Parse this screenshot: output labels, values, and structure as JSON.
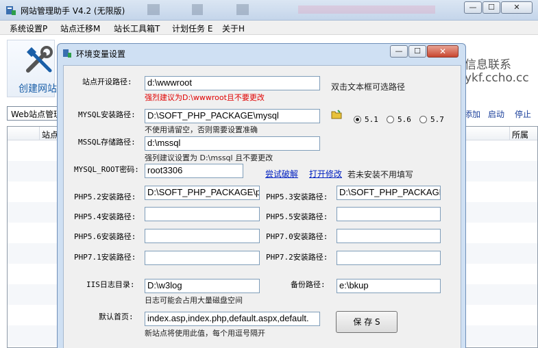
{
  "main": {
    "title": "网站管理助手 V4.2 (无限版)",
    "caption": {
      "min": "—",
      "max": "☐",
      "close": "✕"
    },
    "menu": [
      "系统设置P",
      "站点迁移M",
      "站长工具箱T",
      "计划任务 E",
      "关于H"
    ],
    "toolbar": {
      "create_label": "创建网站",
      "contact_line1": "信息联系",
      "contact_line2": "ykf.ccho.cc"
    },
    "web_field": "Web站点管理",
    "actions": {
      "add": "添加",
      "start": "启动",
      "stop": "停止"
    },
    "table": {
      "col1": "站点",
      "col2": "所属"
    }
  },
  "dialog": {
    "title": "环境变量设置",
    "caption": {
      "min": "—",
      "max": "☐",
      "close": "✕"
    },
    "site_path": {
      "label": "站点开设路径:",
      "value": "d:\\wwwroot",
      "hint": "双击文本框可选路径",
      "warn": "强烈建议为D:\\wwwroot且不要更改"
    },
    "mysql": {
      "label": "MYSQL安装路径:",
      "value": "D:\\SOFT_PHP_PACKAGE\\mysql",
      "note": "不使用请留空，否则需要设置准确"
    },
    "mysql_version": {
      "options": [
        "5.1",
        "5.6",
        "5.7"
      ],
      "selected": "5.1"
    },
    "mssql": {
      "label": "MSSQL存储路径:",
      "value": "d:\\mssql",
      "note": "强列建议设置为 D:\\mssql 且不要更改"
    },
    "mysql_root": {
      "label": "MYSQL_ROOT密码:",
      "value": "root3306",
      "try_link": "尝试破解",
      "open_link": "打开修改",
      "note": "若未安装不用填写"
    },
    "php52": {
      "label": "PHP5.2安装路径:",
      "value": "D:\\SOFT_PHP_PACKAGE\\p"
    },
    "php53": {
      "label": "PHP5.3安装路径:",
      "value": "D:\\SOFT_PHP_PACKAGE"
    },
    "php54": {
      "label": "PHP5.4安装路径:",
      "value": ""
    },
    "php55": {
      "label": "PHP5.5安装路径:",
      "value": ""
    },
    "php56": {
      "label": "PHP5.6安装路径:",
      "value": ""
    },
    "php70": {
      "label": "PHP7.0安装路径:",
      "value": ""
    },
    "php71": {
      "label": "PHP7.1安装路径:",
      "value": ""
    },
    "php72": {
      "label": "PHP7.2安装路径:",
      "value": ""
    },
    "iis_log": {
      "label": "IIS日志目录:",
      "value": "D:\\w3log",
      "note": "日志可能会占用大量磁盘空间"
    },
    "backup": {
      "label": "备份路径:",
      "value": "e:\\bkup"
    },
    "default_page": {
      "label": "默认首页:",
      "value": "index.asp,index.php,default.aspx,default.",
      "note": "新站点将使用此值，每个用逗号隔开"
    },
    "save_label": "保 存 S"
  },
  "colors": {
    "accent": "#1a5fa8",
    "warn": "#e00000",
    "link": "#0020c0",
    "dialog_frame": "#cfe0f3"
  }
}
